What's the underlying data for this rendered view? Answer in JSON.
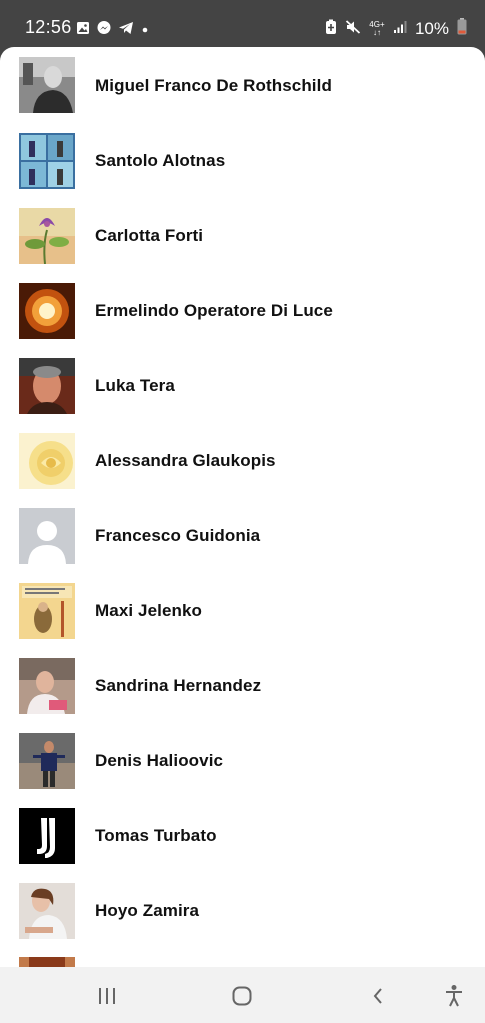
{
  "status_bar": {
    "time": "12:56",
    "battery_pct": "10%",
    "network": "4G+",
    "left_icons": [
      "gallery-icon",
      "messenger-icon",
      "telegram-icon",
      "dot-icon"
    ],
    "right_icons": [
      "battery-saver-icon",
      "mute-icon",
      "network-4g-icon",
      "signal-icon",
      "battery-icon"
    ]
  },
  "contacts": [
    {
      "name": "Miguel Franco De Rothschild",
      "avatar": "photo-man-black-white"
    },
    {
      "name": "Santolo Alotnas",
      "avatar": "comic-collage"
    },
    {
      "name": "Carlotta Forti",
      "avatar": "flower-illustration"
    },
    {
      "name": "Ermelindo Operatore Di Luce",
      "avatar": "glowing-light"
    },
    {
      "name": "Luka Tera",
      "avatar": "photo-man-portrait"
    },
    {
      "name": "Alessandra Glaukopis",
      "avatar": "yellow-rose"
    },
    {
      "name": "Francesco Guidonia",
      "avatar": "default-avatar"
    },
    {
      "name": "Maxi Jelenko",
      "avatar": "cartoon-old-man"
    },
    {
      "name": "Sandrina Hernandez",
      "avatar": "photo-elderly-woman"
    },
    {
      "name": "Denis Halioovic",
      "avatar": "photo-man-standing"
    },
    {
      "name": "Tomas Turbato",
      "avatar": "juventus-logo"
    },
    {
      "name": "Hoyo Zamira",
      "avatar": "photo-woman"
    }
  ],
  "nav_bar": {
    "buttons": [
      "recent-apps",
      "home",
      "back",
      "accessibility"
    ]
  }
}
